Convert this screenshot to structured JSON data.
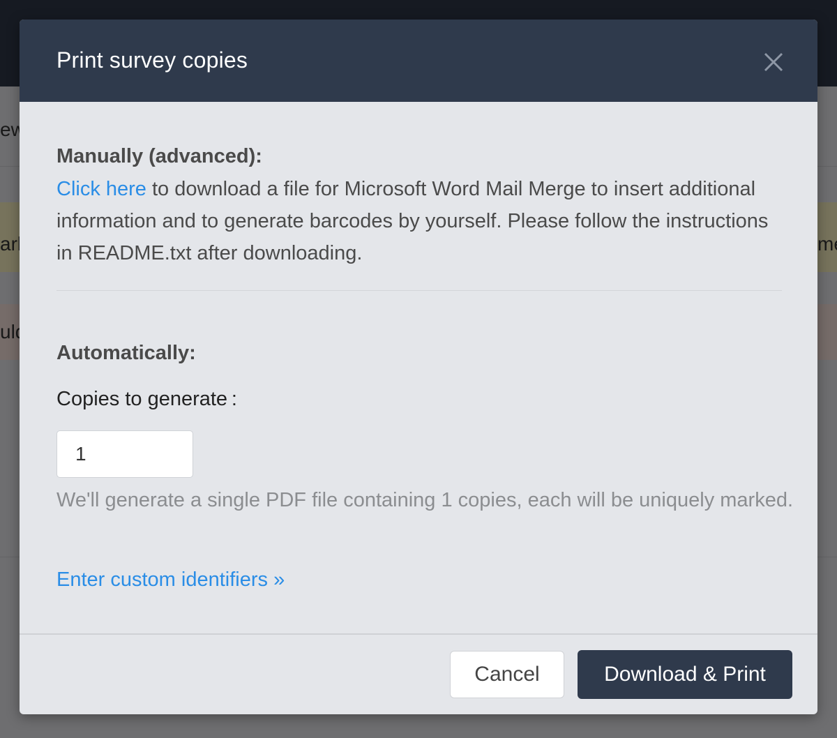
{
  "background": {
    "fragments": [
      "ew",
      "arl",
      "me",
      "uld"
    ]
  },
  "modal": {
    "title": "Print survey copies",
    "manual": {
      "heading": "Manually (advanced):",
      "link_text": "Click here",
      "text": " to download a file for Microsoft Word Mail Merge to insert additional information and to generate barcodes by yourself. Please follow the instructions in README.txt after downloading."
    },
    "automatic": {
      "heading": "Automatically:",
      "copies_label": "Copies to generate :",
      "copies_value": "1",
      "help_text": "We'll generate a single PDF file containing 1 copies, each will be uniquely marked.",
      "custom_link": "Enter custom identifiers »"
    },
    "footer": {
      "cancel_label": "Cancel",
      "primary_label": "Download & Print"
    }
  },
  "icons": {
    "close": "close-icon"
  }
}
